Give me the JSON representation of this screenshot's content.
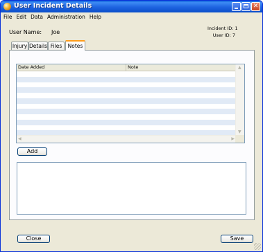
{
  "window": {
    "title": "User Incident Details"
  },
  "menu": [
    "File",
    "Edit",
    "Data",
    "Administration",
    "Help"
  ],
  "header": {
    "username_label": "User Name:",
    "username_value": "Joe",
    "incident_id": "Incident ID: 1",
    "user_id": "User ID: 7"
  },
  "tabs": [
    "Injury",
    "Details",
    "Files",
    "Notes"
  ],
  "active_tab": "Notes",
  "notes_grid": {
    "columns": [
      "Date Added",
      "Note"
    ],
    "rows": []
  },
  "buttons": {
    "add": "Add",
    "close": "Close",
    "save": "Save"
  },
  "note_text": "",
  "colors": {
    "titlebar": "#1e63e0",
    "active_tab_accent": "#ff9d1b",
    "row_stripe": "#e1eaf6"
  }
}
